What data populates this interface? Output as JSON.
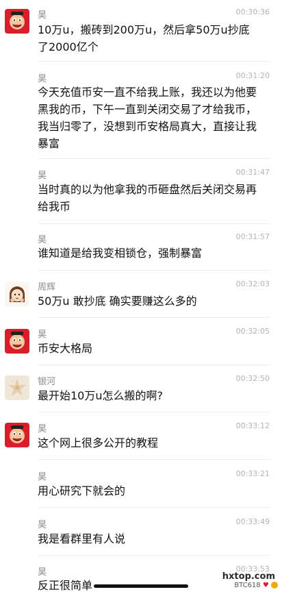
{
  "messages": [
    {
      "sender": "昊",
      "time": "00:30:36",
      "avatar": "red-face-avatar",
      "text": "10万u，搬砖到200万u，然后拿50万u抄底\n了2000亿个"
    },
    {
      "sender": "昊",
      "time": "00:31:20",
      "avatar": "",
      "text": "今天充值币安一直不给我上账，我还以为他要\n黑我的币，下午一直到关闭交易了才给我币，\n我当归零了，没想到币安格局真大，直接让我\n暴富"
    },
    {
      "sender": "昊",
      "time": "00:31:47",
      "avatar": "",
      "text": "当时真的以为他拿我的币砸盘然后关闭交易再\n给我币"
    },
    {
      "sender": "昊",
      "time": "00:31:57",
      "avatar": "",
      "text": "谁知道是给我变相锁仓，强制暴富"
    },
    {
      "sender": "周辉",
      "time": "00:32:03",
      "avatar": "girl-cartoon-avatar",
      "text": "50万u 敢抄底 确实要赚这么多的"
    },
    {
      "sender": "昊",
      "time": "00:32:05",
      "avatar": "red-face-avatar",
      "text": "币安大格局"
    },
    {
      "sender": "银河",
      "time": "00:32:50",
      "avatar": "starfish-avatar",
      "text": "最开始10万u怎么搬的啊?"
    },
    {
      "sender": "昊",
      "time": "00:33:12",
      "avatar": "red-face-avatar",
      "text": "这个网上很多公开的教程"
    },
    {
      "sender": "昊",
      "time": "00:33:21",
      "avatar": "",
      "text": "用心研究下就会的"
    },
    {
      "sender": "昊",
      "time": "00:33:49",
      "avatar": "",
      "text": "我是看群里有人说"
    },
    {
      "sender": "昊",
      "time": "00:33:53",
      "avatar": "",
      "text": "反正很简单"
    }
  ],
  "watermark": {
    "site": "hxtop.com",
    "sub": "BTC618"
  },
  "colors": {
    "avatar_red": "#d81e2b",
    "name_gray": "#8a8a8a",
    "time_gray": "#b3b3b3"
  }
}
